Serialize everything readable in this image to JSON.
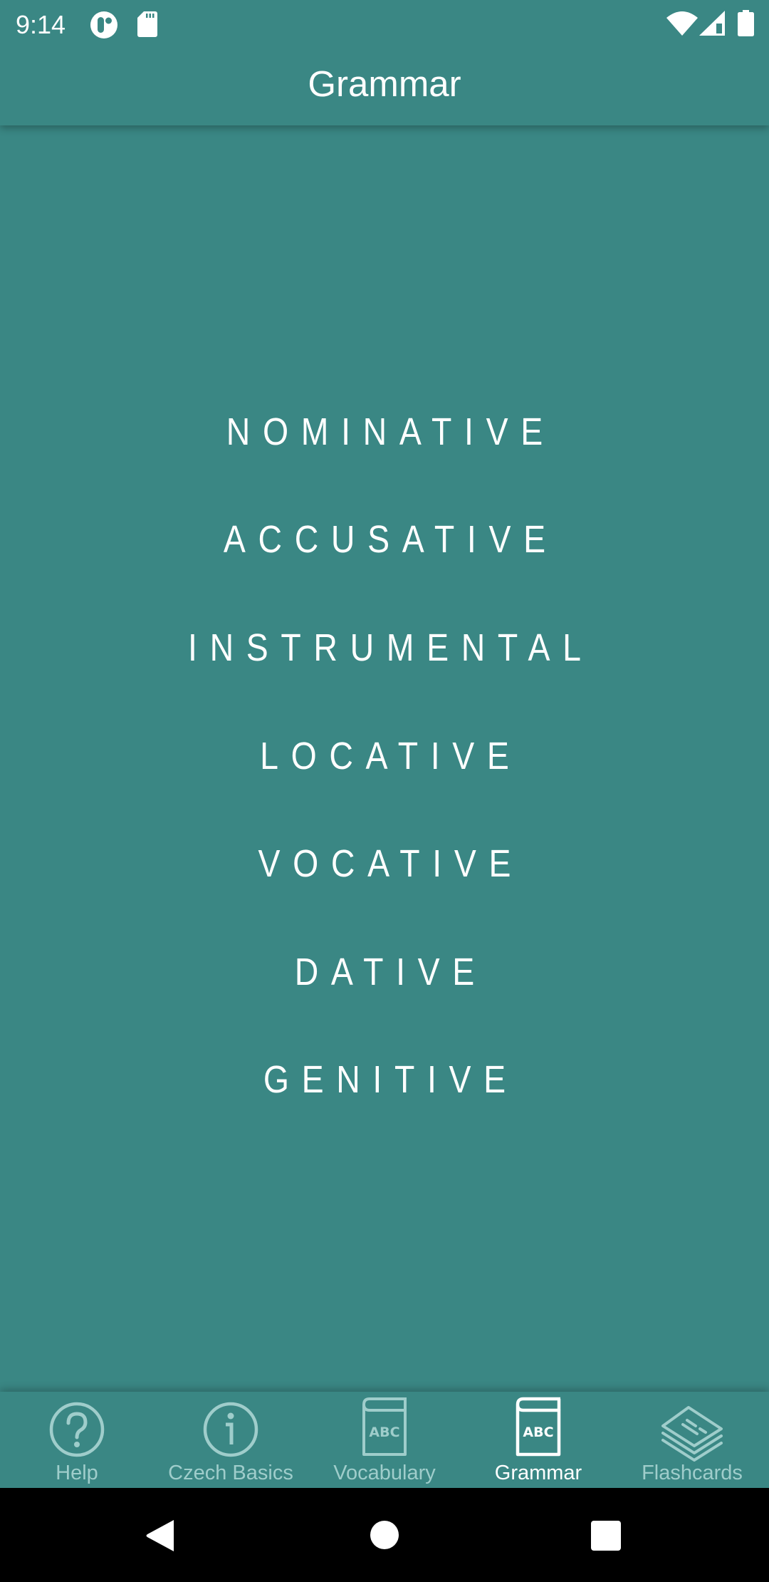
{
  "status_bar": {
    "time": "9:14",
    "left_icons": [
      "app-notification-icon",
      "sd-card-icon"
    ],
    "right_icons": [
      "wifi-icon",
      "cell-signal-icon",
      "battery-icon"
    ]
  },
  "app_bar": {
    "title": "Grammar"
  },
  "cases": [
    {
      "label": "NOMINATIVE"
    },
    {
      "label": "ACCUSATIVE"
    },
    {
      "label": "INSTRUMENTAL"
    },
    {
      "label": "LOCATIVE"
    },
    {
      "label": "VOCATIVE"
    },
    {
      "label": "DATIVE"
    },
    {
      "label": "GENITIVE"
    }
  ],
  "bottom_nav": {
    "items": [
      {
        "label": "Help",
        "icon": "help-circle-icon",
        "active": false
      },
      {
        "label": "Czech Basics",
        "icon": "info-circle-icon",
        "active": false
      },
      {
        "label": "Vocabulary",
        "icon": "abc-book-icon",
        "active": false
      },
      {
        "label": "Grammar",
        "icon": "abc-book-icon",
        "active": true
      },
      {
        "label": "Flashcards",
        "icon": "flashcards-stack-icon",
        "active": false
      }
    ],
    "icon_text": "ABC"
  },
  "colors": {
    "background": "#3A8784",
    "active": "#FFFFFF",
    "inactive": "#9FCDCB",
    "system_nav": "#000000"
  },
  "system_nav": {
    "buttons": [
      "back",
      "home",
      "recents"
    ]
  }
}
